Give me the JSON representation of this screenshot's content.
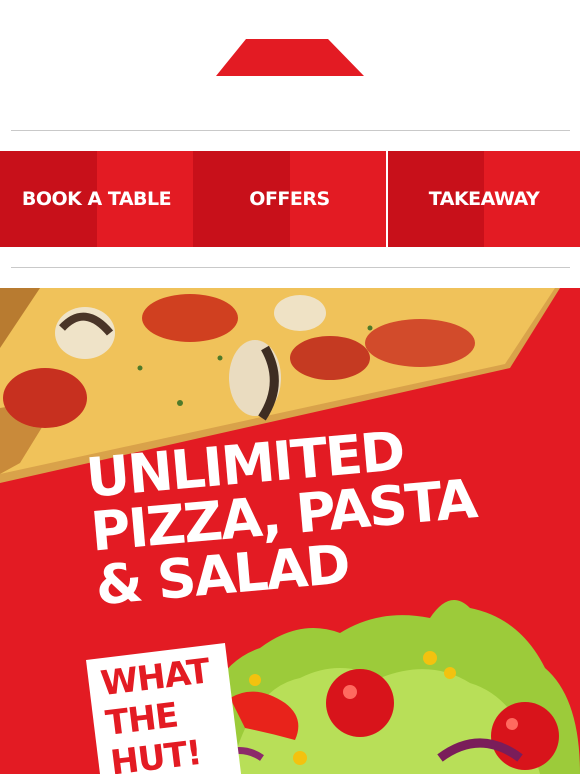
{
  "brand": {
    "logo_icon": "pizza-hut-roof-icon",
    "accent_color": "#e31b23",
    "accent_dark": "#c8101a"
  },
  "nav": {
    "items": [
      {
        "label": "BOOK A TABLE"
      },
      {
        "label": "OFFERS"
      },
      {
        "label": "TAKEAWAY"
      }
    ]
  },
  "hero": {
    "headline": [
      "UNLIMITED",
      "PIZZA, PASTA",
      "& SALAD"
    ],
    "badge": [
      "WHAT",
      "THE",
      "HUT!"
    ],
    "image_top": "pizza-slice-photo",
    "image_bottom": "salad-photo"
  }
}
